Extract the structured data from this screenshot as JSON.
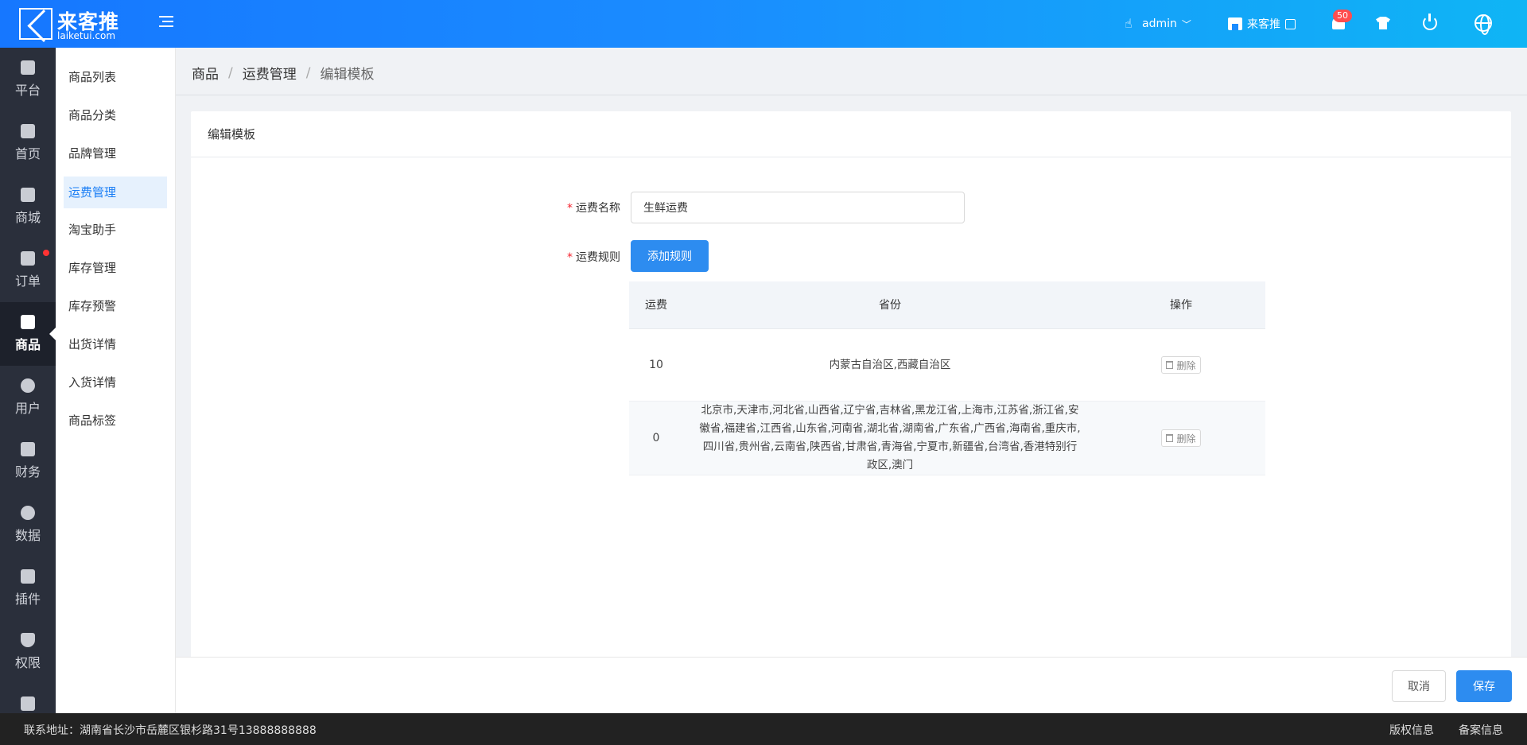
{
  "header": {
    "brand_name": "来客推",
    "brand_domain": "laiketui.com",
    "user": "admin",
    "shop_name": "来客推",
    "notification_count": "50"
  },
  "nav": [
    {
      "label": "平台",
      "icon": "platform-icon"
    },
    {
      "label": "首页",
      "icon": "home-icon"
    },
    {
      "label": "商城",
      "icon": "store-icon"
    },
    {
      "label": "订单",
      "icon": "order-icon"
    },
    {
      "label": "商品",
      "icon": "product-icon"
    },
    {
      "label": "用户",
      "icon": "user-icon"
    },
    {
      "label": "财务",
      "icon": "wallet-icon"
    },
    {
      "label": "数据",
      "icon": "chart-icon"
    },
    {
      "label": "插件",
      "icon": "puzzle-icon"
    },
    {
      "label": "权限",
      "icon": "shield-icon"
    }
  ],
  "submenu": [
    "商品列表",
    "商品分类",
    "品牌管理",
    "运费管理",
    "淘宝助手",
    "库存管理",
    "库存预警",
    "出货详情",
    "入货详情",
    "商品标签"
  ],
  "breadcrumb": [
    "商品",
    "运费管理",
    "编辑模板"
  ],
  "card": {
    "title": "编辑模板",
    "name_label": "运费名称",
    "name_value": "生鲜运费",
    "rule_label": "运费规则",
    "add_rule_button": "添加规则",
    "table": {
      "headers": [
        "运费",
        "省份",
        "操作"
      ],
      "rows": [
        {
          "fee": "10",
          "provinces": "内蒙古自治区,西藏自治区",
          "action": "删除"
        },
        {
          "fee": "0",
          "provinces": "北京市,天津市,河北省,山西省,辽宁省,吉林省,黑龙江省,上海市,江苏省,浙江省,安徽省,福建省,江西省,山东省,河南省,湖北省,湖南省,广东省,广西省,海南省,重庆市,四川省,贵州省,云南省,陕西省,甘肃省,青海省,宁夏市,新疆省,台湾省,香港特别行政区,澳门",
          "action": "删除"
        }
      ]
    }
  },
  "actions": {
    "cancel": "取消",
    "save": "保存"
  },
  "footer": {
    "address": "联系地址：湖南省长沙市岳麓区银杉路31号13888888888",
    "copyright": "版权信息",
    "icp": "备案信息"
  },
  "colors": {
    "accent": "#2d8cf0",
    "header_start": "#1677ff",
    "header_end": "#0fb5f5",
    "nav_bg": "#2a2f3b"
  }
}
